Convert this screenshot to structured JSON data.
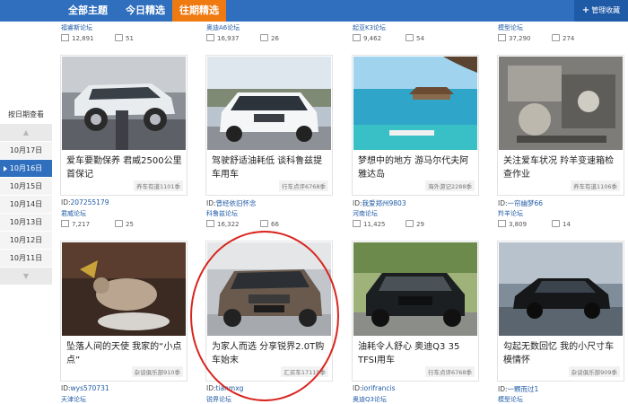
{
  "tabs": [
    {
      "label": "全部主题"
    },
    {
      "label": "今日精选"
    },
    {
      "label": "往期精选"
    }
  ],
  "manage_label": "管理收藏",
  "sidebar": {
    "title": "按日期查看",
    "dates": [
      "10月17日",
      "10月16日",
      "10月15日",
      "10月14日",
      "10月13日",
      "10月12日",
      "10月11日"
    ],
    "active_date": "10月16日"
  },
  "top_row": [
    {
      "forum": "福睿斯论坛",
      "views": "12,891",
      "comments": "51"
    },
    {
      "forum": "奥迪A6论坛",
      "views": "16,937",
      "comments": "26"
    },
    {
      "forum": "起亚K3论坛",
      "views": "9,462",
      "comments": "54"
    },
    {
      "forum": "模型论坛",
      "views": "37,290",
      "comments": "274"
    }
  ],
  "row1": [
    {
      "title": "爱车要勤保养 君威2500公里首保记",
      "source": "养车有道1101季",
      "id_label": "ID:",
      "id_value": "207255179",
      "forum": "君威论坛",
      "views": "7,217",
      "comments": "25"
    },
    {
      "title": "驾驶舒适油耗低 谈科鲁兹提车用车",
      "source": "行车点评6768季",
      "id_label": "ID:",
      "id_value": "曾经依旧怀念",
      "forum": "科鲁兹论坛",
      "views": "16,322",
      "comments": "66"
    },
    {
      "title": "梦想中的地方 游马尔代夫阿雅达岛",
      "source": "海外游记2288季",
      "id_label": "ID:",
      "id_value": "我爱郑州9803",
      "forum": "河南论坛",
      "views": "11,425",
      "comments": "29"
    },
    {
      "title": "关注爱车状况 羚羊变速箱检查作业",
      "source": "养车有道1106季",
      "id_label": "ID:",
      "id_value": "一帘幽梦66",
      "forum": "羚羊论坛",
      "views": "3,809",
      "comments": "14"
    }
  ],
  "row2": [
    {
      "title": "坠落人间的天使 我家的“小点点”",
      "source": "杂谈俱乐部910季",
      "id_label": "ID:",
      "id_value": "wys570731",
      "forum": "天津论坛"
    },
    {
      "title": "为家人而选 分享锐界2.0T购车始末",
      "source": "汇买车17119季",
      "id_label": "ID:",
      "id_value": "tianmxg",
      "forum": "锐界论坛"
    },
    {
      "title": "油耗令人舒心 奥迪Q3 35 TFSI用车",
      "source": "行车点评6768季",
      "id_label": "ID:",
      "id_value": "iorifrancis",
      "forum": "奥迪Q3论坛"
    },
    {
      "title": "勾起无数回忆 我的小尺寸车模情怀",
      "source": "杂谈俱乐部909季",
      "id_label": "ID:",
      "id_value": "一颗而过1",
      "forum": "模型论坛"
    }
  ],
  "colors": {
    "nav": "#2f6fbe",
    "active_tab": "#f07a12",
    "highlight_circle": "#d9241e"
  }
}
